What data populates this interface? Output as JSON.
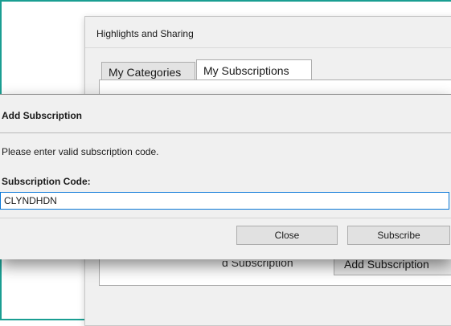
{
  "background_window": {
    "title": "Highlights and Sharing",
    "tabs": [
      {
        "label": "My Categories",
        "active": false
      },
      {
        "label": "My Subscriptions",
        "active": true
      }
    ],
    "add_subscription_button": "Add Subscription",
    "partial_label": "d Subscription"
  },
  "dialog": {
    "title": "Add Subscription",
    "message": "Please enter valid subscription code.",
    "field_label": "Subscription Code:",
    "code_value": "CLYNDHDN",
    "close_label": "Close",
    "subscribe_label": "Subscribe"
  },
  "colors": {
    "accent_frame": "#1a9e92",
    "focus_border": "#0a78d7",
    "dialog_bg": "#f0f0f0"
  }
}
